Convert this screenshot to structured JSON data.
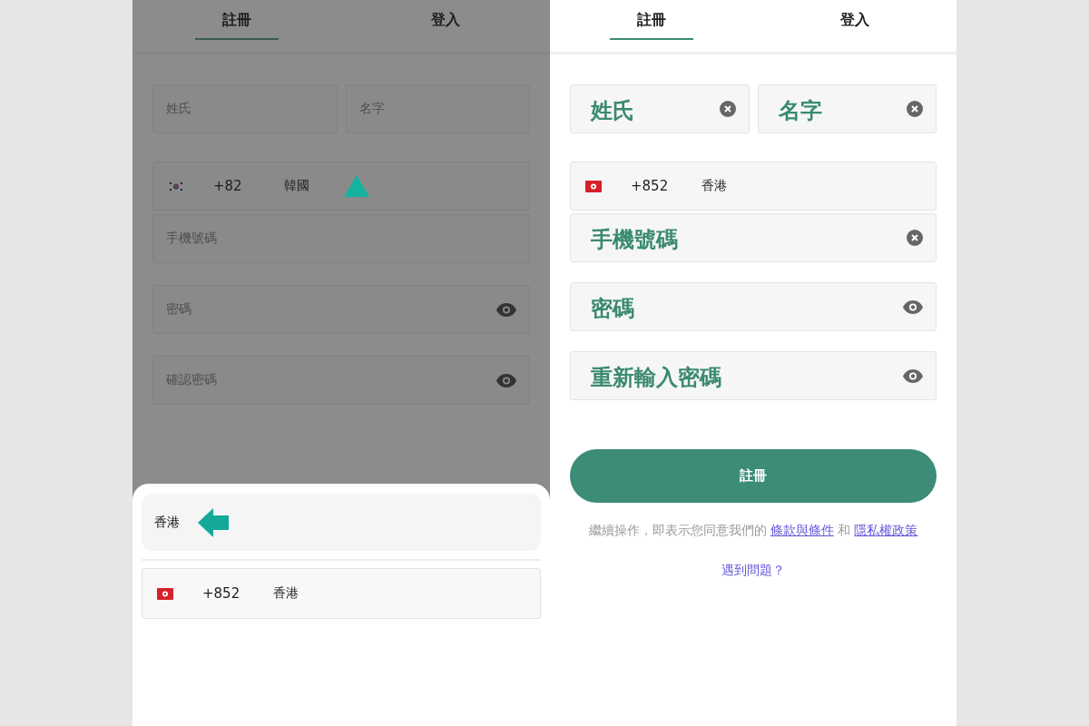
{
  "background_screen": {
    "tabs": [
      {
        "label": "註冊",
        "selected": true
      },
      {
        "label": "登入",
        "selected": false
      }
    ],
    "name_fields": [
      {
        "placeholder": "姓氏"
      },
      {
        "placeholder": "名字"
      }
    ],
    "country": {
      "code": "+82",
      "name": "韓國"
    },
    "fields": [
      {
        "placeholder": "手機號碼",
        "kind": "plain"
      },
      {
        "placeholder": "密碼",
        "kind": "password"
      },
      {
        "placeholder": "確認密碼",
        "kind": "password"
      }
    ]
  },
  "country_sheet": {
    "search": {
      "value": "香港"
    },
    "results": [
      {
        "code": "+852",
        "name": "香港"
      }
    ]
  },
  "screen": {
    "tabs": [
      {
        "label": "註冊",
        "selected": true
      },
      {
        "label": "登入",
        "selected": false
      }
    ],
    "name_fields": [
      {
        "label": "姓氏",
        "kind": "clearable"
      },
      {
        "label": "名字",
        "kind": "clearable"
      }
    ],
    "country": {
      "code": "+852",
      "name": "香港"
    },
    "fields": [
      {
        "label": "手機號碼",
        "kind": "clearable"
      },
      {
        "label": "密碼",
        "kind": "password"
      },
      {
        "label": "重新輸入密碼",
        "kind": "password"
      }
    ],
    "submit": "註冊",
    "terms": {
      "text": "繼續操作，即表示您同意我們的",
      "link_1": "條款與條件",
      "joiner": "和",
      "link_2": "隱私權政策"
    },
    "help": "遇到問題？"
  }
}
